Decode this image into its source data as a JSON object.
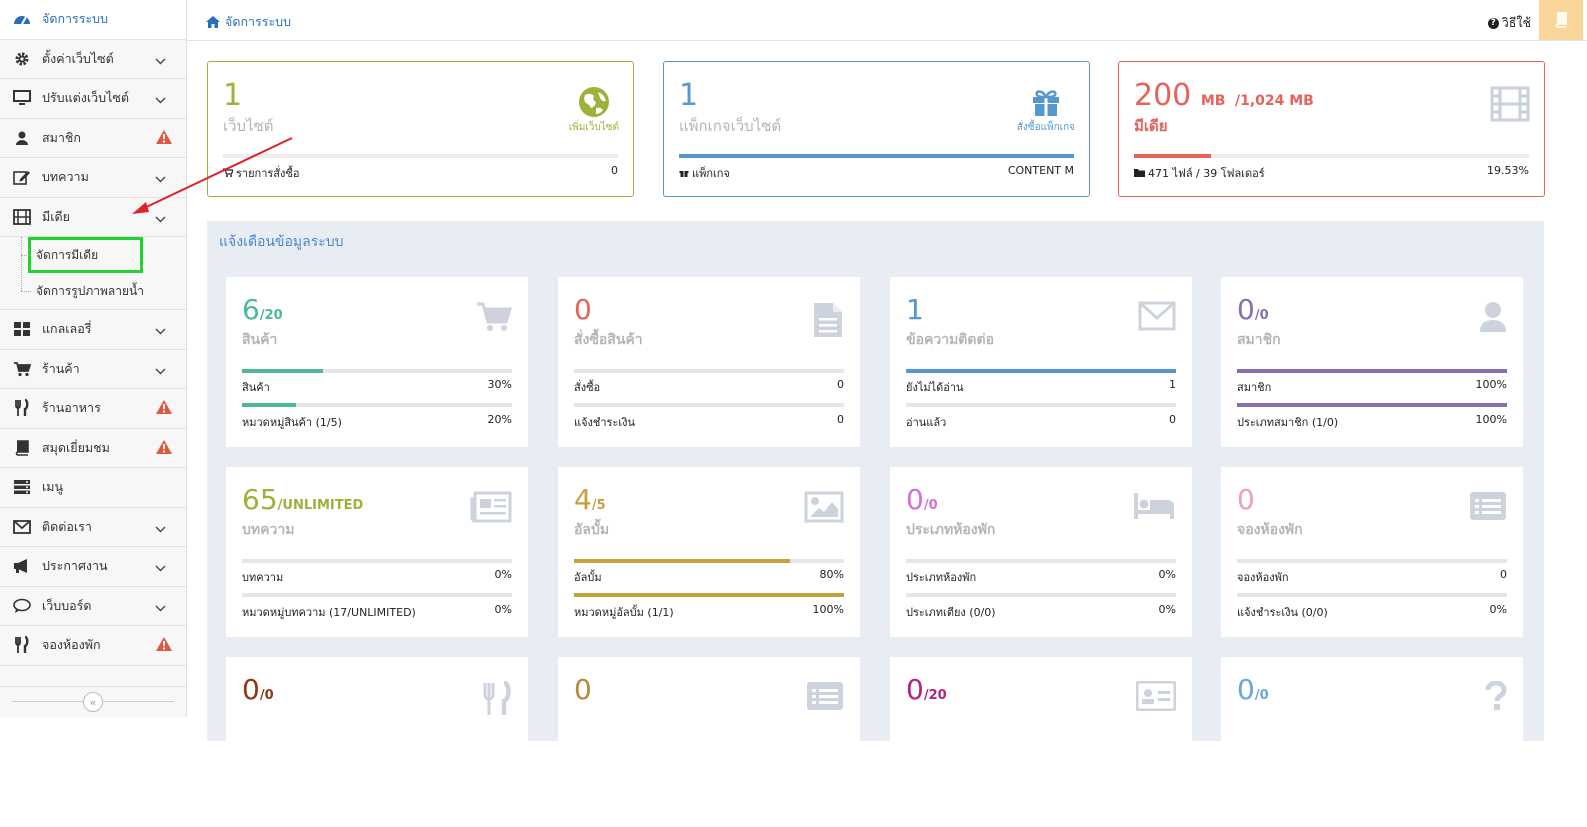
{
  "colors": {
    "green": "#9db23a",
    "blue": "#5597cf",
    "red": "#e8625a",
    "teal": "#4cb79a",
    "purple": "#8a6fb0",
    "pink": "#d470d6",
    "magenta": "#b6237a",
    "gold": "#c3a23a",
    "lightpink": "#f1a1b1",
    "lightblue": "#6aa7dc"
  },
  "sidebar": {
    "items": [
      {
        "label": "จัดการระบบ",
        "icon": "dashboard-icon",
        "active": true
      },
      {
        "label": "ตั้งค่าเว็บไซต์",
        "icon": "gear-icon",
        "chevron": true
      },
      {
        "label": "ปรับแต่งเว็บไซต์",
        "icon": "monitor-icon",
        "chevron": true
      },
      {
        "label": "สมาชิก",
        "icon": "user-icon",
        "warn": true
      },
      {
        "label": "บทความ",
        "icon": "edit-icon",
        "chevron": true
      },
      {
        "label": "มีเดีย",
        "icon": "film-icon",
        "chevron": true,
        "open": true
      }
    ],
    "sub": [
      "จัดการมีเดีย",
      "จัดการรูปภาพลายน้ำ"
    ],
    "items2": [
      {
        "label": "แกลเลอรี่",
        "icon": "grid-icon",
        "chevron": true
      },
      {
        "label": "ร้านค้า",
        "icon": "cart-icon",
        "chevron": true
      },
      {
        "label": "ร้านอาหาร",
        "icon": "cutlery-icon",
        "warn": true
      },
      {
        "label": "สมุดเยี่ยมชม",
        "icon": "book-icon",
        "warn": true
      },
      {
        "label": "เมนู",
        "icon": "menu-icon"
      },
      {
        "label": "ติดต่อเรา",
        "icon": "envelope-icon",
        "chevron": true
      },
      {
        "label": "ประกาศงาน",
        "icon": "megaphone-icon",
        "chevron": true
      },
      {
        "label": "เว็บบอร์ด",
        "icon": "comments-icon",
        "chevron": true
      },
      {
        "label": "จองห้องพัก",
        "icon": "cutlery-icon",
        "warn": true
      }
    ]
  },
  "header": {
    "breadcrumb": "จัดการระบบ",
    "help": "วิธีใช้"
  },
  "topcards": [
    {
      "num": "1",
      "title": "เว็บไซต์",
      "action": "เพิ่มเว็บไซต์",
      "footL": "รายการสั่งซื้อ",
      "footR": "0",
      "progress": 0
    },
    {
      "num": "1",
      "title": "แพ็กเกจเว็บไซต์",
      "action": "สั่งซื้อแพ็กเกจ",
      "footL": "แพ็กเกจ",
      "footR": "CONTENT M",
      "progress": 100
    },
    {
      "num": "200",
      "unit": "MB",
      "total": "/1,024 MB",
      "title": "มีเดีย",
      "footL": "471 ไฟล์ / 39 โฟลเดอร์",
      "footR": "19.53%",
      "progress": 19.53
    }
  ],
  "panel_title": "แจ้งเตือนข้อมูลระบบ",
  "cards": [
    {
      "big": "6",
      "small": "/20",
      "name": "สินค้า",
      "icon": "cart-icon",
      "color": "teal",
      "r1l": "สินค้า",
      "r1r": "30%",
      "p1": 30,
      "r2l": "หมวดหมู่สินค้า (1/5)",
      "r2r": "20%",
      "p2": 20
    },
    {
      "big": "0",
      "small": "",
      "name": "สั่งซื้อสินค้า",
      "icon": "file-icon",
      "color": "red",
      "r1l": "สั่งซื้อ",
      "r1r": "0",
      "p1": 0,
      "r2l": "แจ้งชำระเงิน",
      "r2r": "0",
      "p2": 0
    },
    {
      "big": "1",
      "small": "",
      "name": "ข้อความติดต่อ",
      "icon": "envelope-icon",
      "color": "blue",
      "r1l": "ยังไม่ได้อ่าน",
      "r1r": "1",
      "p1": 100,
      "r2l": "อ่านแล้ว",
      "r2r": "0",
      "p2": 0
    },
    {
      "big": "0",
      "small": "/0",
      "name": "สมาชิก",
      "icon": "user-icon",
      "color": "purple",
      "r1l": "สมาชิก",
      "r1r": "100%",
      "p1": 100,
      "r2l": "ประเภทสมาชิก (1/0)",
      "r2r": "100%",
      "p2": 100
    },
    {
      "big": "65",
      "small": "/UNLIMITED",
      "name": "บทความ",
      "icon": "newspaper-icon",
      "color": "green",
      "r1l": "บทความ",
      "r1r": "0%",
      "p1": 0,
      "r2l": "หมวดหมู่บทความ (17/UNLIMITED)",
      "r2r": "0%",
      "p2": 0
    },
    {
      "big": "4",
      "small": "/5",
      "name": "อัลบั้ม",
      "icon": "image-icon",
      "color": "gold",
      "r1l": "อัลบั้ม",
      "r1r": "80%",
      "p1": 80,
      "r2l": "หมวดหมู่อัลบั้ม (1/1)",
      "r2r": "100%",
      "p2": 100
    },
    {
      "big": "0",
      "small": "/0",
      "name": "ประเภทห้องพัก",
      "icon": "bed-icon",
      "color": "pink",
      "r1l": "ประเภทห้องพัก",
      "r1r": "0%",
      "p1": 0,
      "r2l": "ประเภทเตียง (0/0)",
      "r2r": "0%",
      "p2": 0
    },
    {
      "big": "0",
      "small": "",
      "name": "จองห้องพัก",
      "icon": "list-icon",
      "color": "lightpink",
      "r1l": "จองห้องพัก",
      "r1r": "0",
      "p1": 0,
      "r2l": "แจ้งชำระเงิน (0/0)",
      "r2r": "0%",
      "p2": 0
    },
    {
      "big": "0",
      "small": "/0",
      "name": "",
      "icon": "cutlery-icon",
      "color": "#8a3a1a"
    },
    {
      "big": "0",
      "small": "",
      "name": "",
      "icon": "list-icon",
      "color": "#b78a3a"
    },
    {
      "big": "0",
      "small": "/20",
      "name": "",
      "icon": "idcard-icon",
      "color": "magenta"
    },
    {
      "big": "0",
      "small": "/0",
      "name": "",
      "icon": "question-icon",
      "color": "lightblue"
    }
  ]
}
